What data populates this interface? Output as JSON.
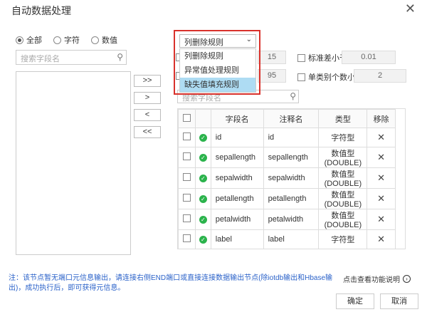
{
  "dialog": {
    "title": "自动数据处理",
    "close_symbol": "✕"
  },
  "filter": {
    "options": [
      {
        "label": "全部",
        "checked": true
      },
      {
        "label": "字符",
        "checked": false
      },
      {
        "label": "数值",
        "checked": false
      }
    ]
  },
  "left_search": {
    "placeholder": "搜索字段名"
  },
  "move_buttons": [
    ">>",
    ">",
    "<",
    "<<"
  ],
  "rules_dropdown": {
    "selected": "列删除规则",
    "items": [
      {
        "label": "列删除规则",
        "active": false
      },
      {
        "label": "异常值处理规则",
        "active": false
      },
      {
        "label": "缺失值填充规则",
        "active": true
      }
    ]
  },
  "options": {
    "partial_value_1": "15",
    "partial_value_2": "95",
    "std_label": "标准差小于",
    "std_value": "0.01",
    "single_class_label": "单类别个数小于",
    "single_class_value": "2"
  },
  "right_search": {
    "placeholder": "搜索字段名"
  },
  "table": {
    "headers": [
      "字段名",
      "注释名",
      "类型",
      "移除"
    ],
    "rows": [
      {
        "name": "id",
        "comment": "id",
        "type": "字符型"
      },
      {
        "name": "sepallength",
        "comment": "sepallength",
        "type": "数值型(DOUBLE)"
      },
      {
        "name": "sepalwidth",
        "comment": "sepalwidth",
        "type": "数值型(DOUBLE)"
      },
      {
        "name": "petallength",
        "comment": "petallength",
        "type": "数值型(DOUBLE)"
      },
      {
        "name": "petalwidth",
        "comment": "petalwidth",
        "type": "数值型(DOUBLE)"
      },
      {
        "name": "label",
        "comment": "label",
        "type": "字符型"
      }
    ]
  },
  "note": "注：该节点暂无端口元信息输出，请连接右侧END端口或直接连接数据输出节点(除iotdb输出和Hbase输出)，成功执行后，即可获得元信息。",
  "help_link": "点击查看功能说明",
  "footer": {
    "confirm": "确定",
    "cancel": "取消"
  },
  "colors": {
    "highlight_border": "#d9312b",
    "active_item": "#aedcf3",
    "ok_icon": "#2bb34c",
    "note_text": "#2b62c9"
  }
}
